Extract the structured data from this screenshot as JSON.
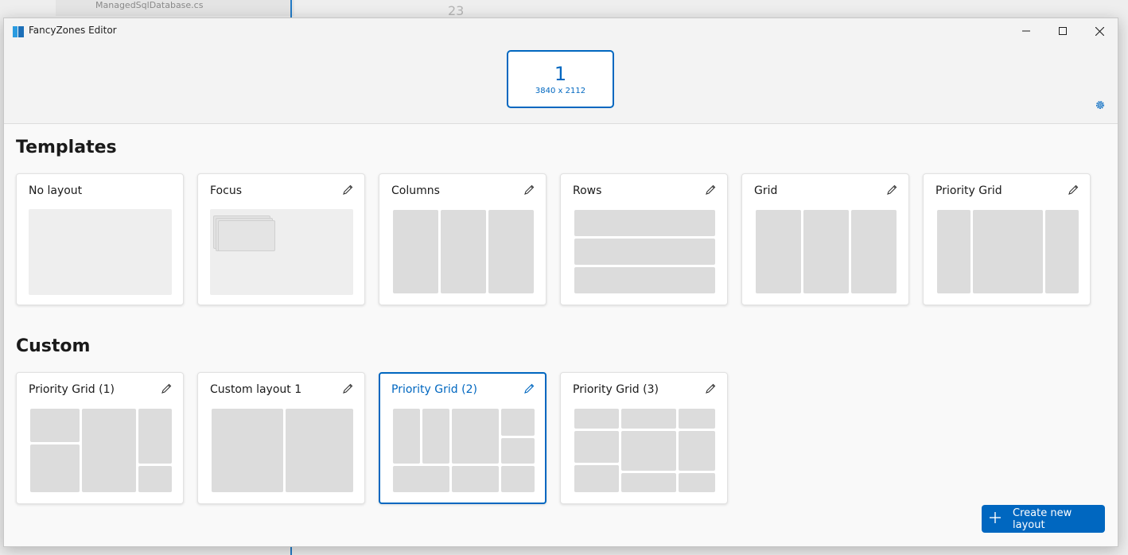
{
  "window": {
    "title": "FancyZones Editor"
  },
  "background_app": {
    "file_label": "ManagedSqlDatabase.cs",
    "line_number": "23"
  },
  "monitor": {
    "number": "1",
    "resolution": "3840 x 2112"
  },
  "templates": {
    "heading": "Templates",
    "items": [
      {
        "name": "No layout",
        "editable": false
      },
      {
        "name": "Focus",
        "editable": true
      },
      {
        "name": "Columns",
        "editable": true
      },
      {
        "name": "Rows",
        "editable": true
      },
      {
        "name": "Grid",
        "editable": true
      },
      {
        "name": "Priority Grid",
        "editable": true
      }
    ]
  },
  "custom": {
    "heading": "Custom",
    "items": [
      {
        "name": "Priority Grid (1)",
        "selected": false
      },
      {
        "name": "Custom layout 1",
        "selected": false
      },
      {
        "name": "Priority Grid (2)",
        "selected": true
      },
      {
        "name": "Priority Grid (3)",
        "selected": false
      }
    ]
  },
  "actions": {
    "create_label": "Create new layout"
  },
  "icons": {
    "app": "fancyzones-icon",
    "minimize": "minimize-icon",
    "maximize": "maximize-icon",
    "close": "close-icon",
    "settings": "gear-icon",
    "edit": "pencil-icon",
    "add": "plus-icon"
  },
  "colors": {
    "accent": "#0067c0",
    "zone": "#dcdcdc",
    "card": "#ffffff"
  }
}
